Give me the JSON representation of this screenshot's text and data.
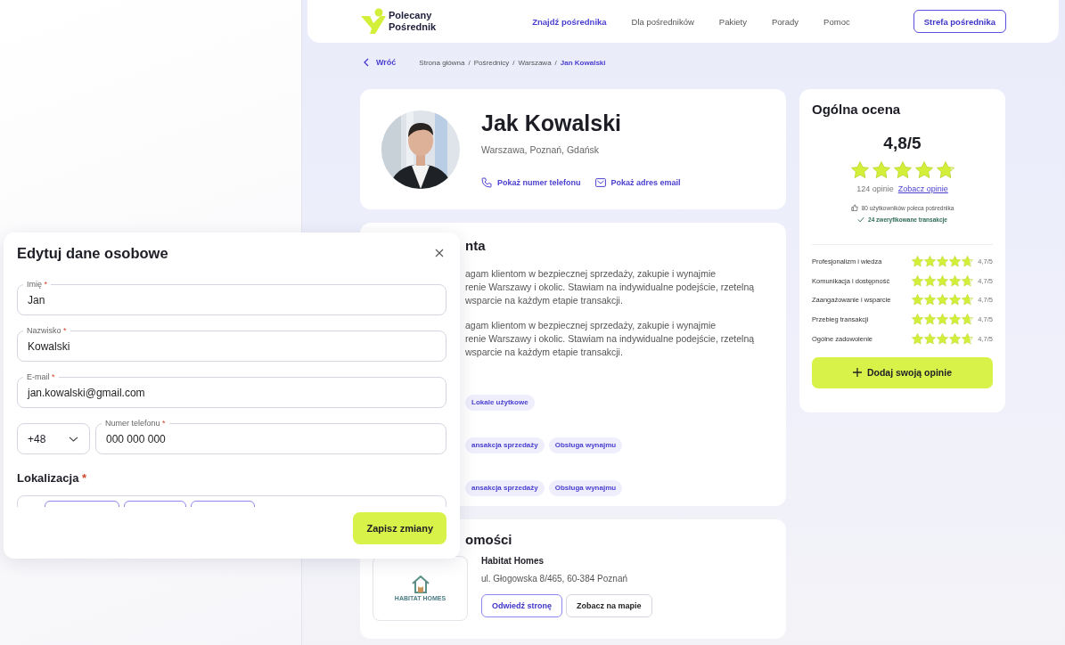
{
  "header": {
    "logo": "Polecany\nPośrednik",
    "nav": [
      {
        "label": "Znajdź pośrednika",
        "selected": true
      },
      {
        "label": "Dla pośredników",
        "selected": false
      },
      {
        "label": "Pakiety",
        "selected": false
      },
      {
        "label": "Porady",
        "selected": false
      },
      {
        "label": "Pomoc",
        "selected": false
      }
    ],
    "cta": "Strefa pośrednika"
  },
  "breadcrumb": {
    "back": "Wróć",
    "items": [
      {
        "label": "Strona główna",
        "selected": false
      },
      {
        "sep": "/",
        "label": "Pośrednicy",
        "selected": false
      },
      {
        "sep": "/",
        "label": "Warszawa",
        "selected": false
      },
      {
        "sep": "/",
        "label": "Jan Kowalski",
        "selected": true
      }
    ]
  },
  "profile": {
    "name": "Jak Kowalski",
    "cities": "Warszawa, Poznań, Gdańsk",
    "actions": [
      {
        "kind": "phone",
        "label": "Pokaż numer telefonu"
      },
      {
        "kind": "email",
        "label": "Pokaż adres email"
      }
    ]
  },
  "about": {
    "title": "nta",
    "paragraphs": [
      "agam klientom w bezpiecznej sprzedaży, zakupie i wynajmie\nrenie Warszawy i okolic. Stawiam na indywidualne podejście, rzetelną\nwsparcie na każdym etapie transakcji.",
      "agam klientom w bezpiecznej sprzedaży, zakupie i wynajmie\nrenie Warszawy i okolic. Stawiam na indywidualne podejście, rzetelną\nwsparcie na każdym etapie transakcji."
    ],
    "tag_rows": [
      [
        "Lokale użytkowe"
      ],
      [
        "ansakcja sprzedaży",
        "Obsługa wynajmu"
      ],
      [
        "ansakcja sprzedaży",
        "Obsługa wynajmu"
      ]
    ]
  },
  "agency": {
    "title": "omości",
    "logo_text": "HABITAT HOMES",
    "name": "Habitat Homes",
    "address": "ul. Głogowska 8/465, 60-384 Poznań",
    "buttons": [
      {
        "kind": "primary",
        "label": "Odwiedź stronę"
      },
      {
        "kind": "secondary",
        "label": "Zobacz na mapie"
      }
    ]
  },
  "rating": {
    "title": "Ogólna ocena",
    "score": "4,8/5",
    "stars": 4.8,
    "count": "124 opinie",
    "link": "Zobacz opinie",
    "facts": [
      {
        "kind": "recommend",
        "text": "80 użytkowników poleca pośrednika"
      },
      {
        "kind": "verified",
        "text": "24 zweryfikowane transakcje"
      }
    ],
    "categories": [
      {
        "label": "Profesjonalizm i wiedza",
        "stars": 4.7,
        "score": "4,7/5"
      },
      {
        "label": "Komunikacja i dostępność",
        "stars": 4.7,
        "score": "4,7/5"
      },
      {
        "label": "Zaangażowanie i wsparcie",
        "stars": 4.7,
        "score": "4,7/5"
      },
      {
        "label": "Przebieg transakcji",
        "stars": 4.7,
        "score": "4,7/5"
      },
      {
        "label": "Ogólne zadowolenie",
        "stars": 4.7,
        "score": "4,7/5"
      }
    ],
    "button": "Dodaj swoją opinie"
  },
  "modal": {
    "title": "Edytuj dane osobowe",
    "fields": [
      {
        "label": "Imię",
        "mark": "*",
        "value": "Jan"
      },
      {
        "label": "Nazwisko",
        "mark": "*",
        "value": "Kowalski"
      },
      {
        "label": "E-mail",
        "mark": "*",
        "value": "jan.kowalski@gmail.com"
      }
    ],
    "phone": {
      "prefix": "+48",
      "label": "Numer telefonu",
      "mark": "*",
      "value": "000 000 000"
    },
    "section": {
      "label": "Lokalizacja",
      "mark": "*"
    },
    "save": "Zapisz zmiany"
  }
}
